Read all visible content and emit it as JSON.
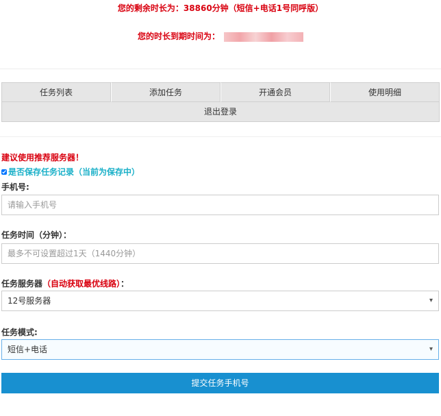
{
  "header": {
    "remaining_text": "您的剩余时长为：38860分钟（短信+电话1号同呼版）",
    "expire_label": "您的时长到期时间为："
  },
  "nav": {
    "row1": [
      "任务列表",
      "添加任务",
      "开通会员",
      "使用明细"
    ],
    "logout": "退出登录"
  },
  "form": {
    "recommend": "建议使用推荐服务器！",
    "save_record": "是否保存任务记录（当前为保存中）",
    "phone_label": "手机号:",
    "phone_placeholder": "请输入手机号",
    "time_label": "任务时间（分钟）：",
    "time_placeholder": "最多不可设置超过1天（1440分钟）",
    "server_label": "任务服务器",
    "server_hint": "（自动获取最优线路）",
    "server_label_suffix": "：",
    "server_value": "12号服务器",
    "mode_label": "任务模式:",
    "mode_value": "短信+电话",
    "submit": "提交任务手机号"
  },
  "colors": {
    "alert_red": "#d9000f",
    "teal": "#1ab0c8",
    "button_blue": "#1890d0"
  }
}
